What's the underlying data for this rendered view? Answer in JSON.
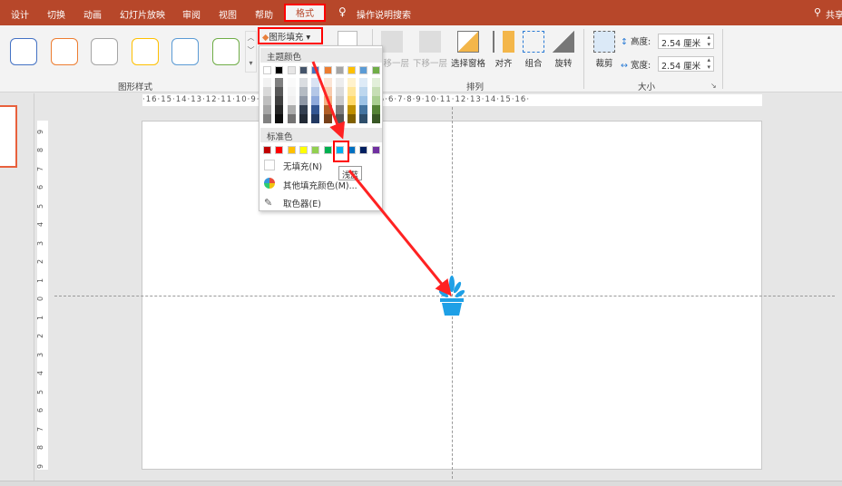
{
  "tabs": [
    "设计",
    "切换",
    "动画",
    "幻灯片放映",
    "审阅",
    "视图",
    "帮助"
  ],
  "active_tab": "格式",
  "search_label": "操作说明搜索",
  "share_label": "共享",
  "ribbon": {
    "shape_styles_label": "图形样式",
    "shape_style_colors": [
      "#4472c4",
      "#ed7d31",
      "#a5a5a5",
      "#ffc000",
      "#5b9bd5",
      "#70ad47"
    ],
    "fill_button": "图形填充",
    "arrange_label": "排列",
    "bring_forward": "上移一层",
    "send_backward": "下移一层",
    "selection_pane": "选择窗格",
    "align": "对齐",
    "group": "组合",
    "rotate": "旋转",
    "size_label": "大小",
    "crop": "裁剪",
    "height_label": "高度:",
    "height_value": "2.54 厘米",
    "width_label": "宽度:",
    "width_value": "2.54 厘米"
  },
  "ruler_h": "·16·15·14·13·12·11·10·9·8·7·6·5·4·3·2·1·0·1·2·3·4·5·6·7·8·9·10·11·12·13·14·15·16·",
  "fill_menu": {
    "theme_header": "主题颜色",
    "theme_colors": [
      "#ffffff",
      "#000000",
      "#e7e6e6",
      "#44546a",
      "#4472c4",
      "#ed7d31",
      "#a5a5a5",
      "#ffc000",
      "#5b9bd5",
      "#70ad47"
    ],
    "standard_header": "标准色",
    "standard_colors": [
      "#c00000",
      "#ff0000",
      "#ffc000",
      "#ffff00",
      "#92d050",
      "#00b050",
      "#00b0f0",
      "#0070c0",
      "#002060",
      "#7030a0"
    ],
    "no_fill": "无填充(N)",
    "more_colors": "其他填充颜色(M)...",
    "eyedropper": "取色器(E)",
    "tooltip": "浅蓝"
  },
  "accent": "#b7472a",
  "icon_color": "#1ea0e6"
}
